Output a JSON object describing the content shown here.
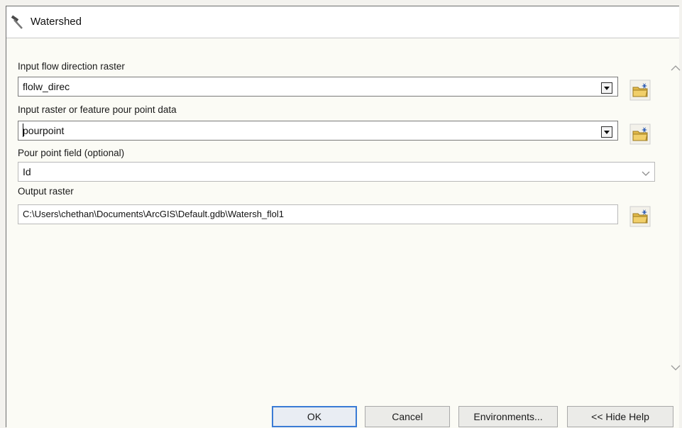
{
  "window": {
    "title": "Watershed"
  },
  "form": {
    "flow_dir": {
      "label": "Input flow direction raster",
      "value": "flolw_direc"
    },
    "pour_point": {
      "label": "Input raster or feature pour point data",
      "value": "pourpoint"
    },
    "pour_field": {
      "label": "Pour point field (optional)",
      "value": "Id"
    },
    "output": {
      "label": "Output raster",
      "value": "C:\\Users\\chethan\\Documents\\ArcGIS\\Default.gdb\\Watersh_flol1"
    }
  },
  "buttons": {
    "ok": "OK",
    "cancel": "Cancel",
    "environments": "Environments...",
    "hide_help": "<< Hide Help"
  },
  "icons": {
    "title": "hammer-icon",
    "browse": "folder-icon",
    "dropdown": "chevron-down-icon",
    "scroll_up": "chevron-up-icon",
    "scroll_down": "chevron-down-icon"
  },
  "colors": {
    "ok_border": "#3a7bd5",
    "folder": "#e2b94a"
  }
}
